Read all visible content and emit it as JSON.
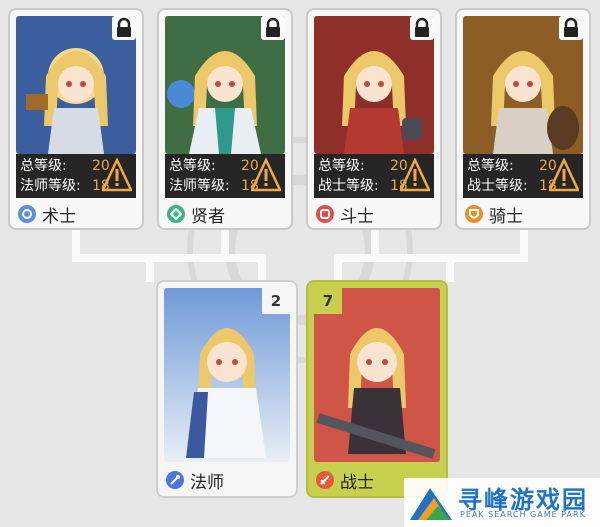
{
  "advanced_classes": [
    {
      "name": "术士",
      "total_label": "总等级:",
      "total_level": "20",
      "sub_label": "法师等级:",
      "sub_level": "18",
      "bg": "#3b5f9e",
      "badge_color": "#5a8fe0",
      "locked": true
    },
    {
      "name": "贤者",
      "total_label": "总等级:",
      "total_level": "20",
      "sub_label": "法师等级:",
      "sub_level": "18",
      "bg": "#3f6e45",
      "badge_color": "#3ab68a",
      "locked": true
    },
    {
      "name": "斗士",
      "total_label": "总等级:",
      "total_level": "20",
      "sub_label": "战士等级:",
      "sub_level": "18",
      "bg": "#8e2f2a",
      "badge_color": "#e0504a",
      "locked": true
    },
    {
      "name": "骑士",
      "total_label": "总等级:",
      "total_level": "20",
      "sub_label": "战士等级:",
      "sub_level": "18",
      "bg": "#8c5e26",
      "badge_color": "#e8902e",
      "locked": true
    }
  ],
  "base_classes": {
    "mage": {
      "name": "法师",
      "count": "2",
      "bg": "#6f9ad8",
      "badge_color": "#4a78dc"
    },
    "warrior": {
      "name": "战士",
      "count": "7",
      "bg": "#cf5547",
      "badge_color": "#e55a3c"
    }
  },
  "colors": {
    "level_number": "#f0a840",
    "warning": "#f0a840",
    "selected_border": "#c7cf4f"
  },
  "watermark": {
    "title": "寻峰游戏园",
    "subtitle": "PEAK SEARCH GAME PARK"
  }
}
